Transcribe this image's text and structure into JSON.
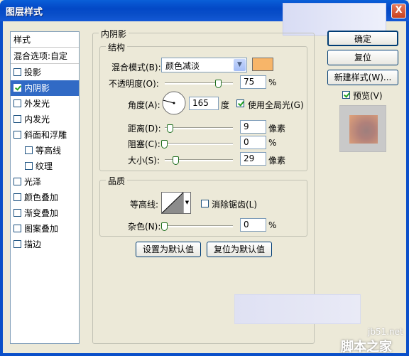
{
  "window": {
    "title": "图层样式",
    "close_label": "X"
  },
  "sidebar": {
    "header": "样式",
    "blend_options": "混合选项:自定",
    "items": [
      {
        "label": "投影",
        "checked": false
      },
      {
        "label": "内阴影",
        "checked": true,
        "selected": true
      },
      {
        "label": "外发光",
        "checked": false
      },
      {
        "label": "内发光",
        "checked": false
      },
      {
        "label": "斜面和浮雕",
        "checked": false
      },
      {
        "label": "等高线",
        "checked": false,
        "indent": true
      },
      {
        "label": "纹理",
        "checked": false,
        "indent": true
      },
      {
        "label": "光泽",
        "checked": false
      },
      {
        "label": "颜色叠加",
        "checked": false
      },
      {
        "label": "渐变叠加",
        "checked": false
      },
      {
        "label": "图案叠加",
        "checked": false
      },
      {
        "label": "描边",
        "checked": false
      }
    ]
  },
  "panel": {
    "title": "内阴影",
    "structure": {
      "title": "结构",
      "blend_mode_label": "混合模式(B):",
      "blend_mode_value": "颜色减淡",
      "color": "#f7b569",
      "opacity_label": "不透明度(O):",
      "opacity_value": "75",
      "opacity_unit": "%",
      "opacity_fraction": 0.75,
      "angle_label": "角度(A):",
      "angle_value": "165",
      "angle_unit": "度",
      "global_light_label": "使用全局光(G)",
      "global_light_checked": true,
      "distance_label": "距离(D):",
      "distance_value": "9",
      "distance_unit": "像素",
      "choke_label": "阻塞(C):",
      "choke_value": "0",
      "choke_unit": "%",
      "size_label": "大小(S):",
      "size_value": "29",
      "size_unit": "像素"
    },
    "quality": {
      "title": "品质",
      "contour_label": "等高线:",
      "antialias_label": "消除锯齿(L)",
      "antialias_checked": false,
      "noise_label": "杂色(N):",
      "noise_value": "0",
      "noise_unit": "%"
    },
    "set_default_label": "设置为默认值",
    "reset_default_label": "复位为默认值"
  },
  "buttons": {
    "ok": "确定",
    "reset": "复位",
    "new_style": "新建样式(W)...",
    "preview_label": "预览(V)",
    "preview_checked": true
  },
  "watermark": {
    "site": "jb51.net",
    "name": "脚本之家"
  }
}
